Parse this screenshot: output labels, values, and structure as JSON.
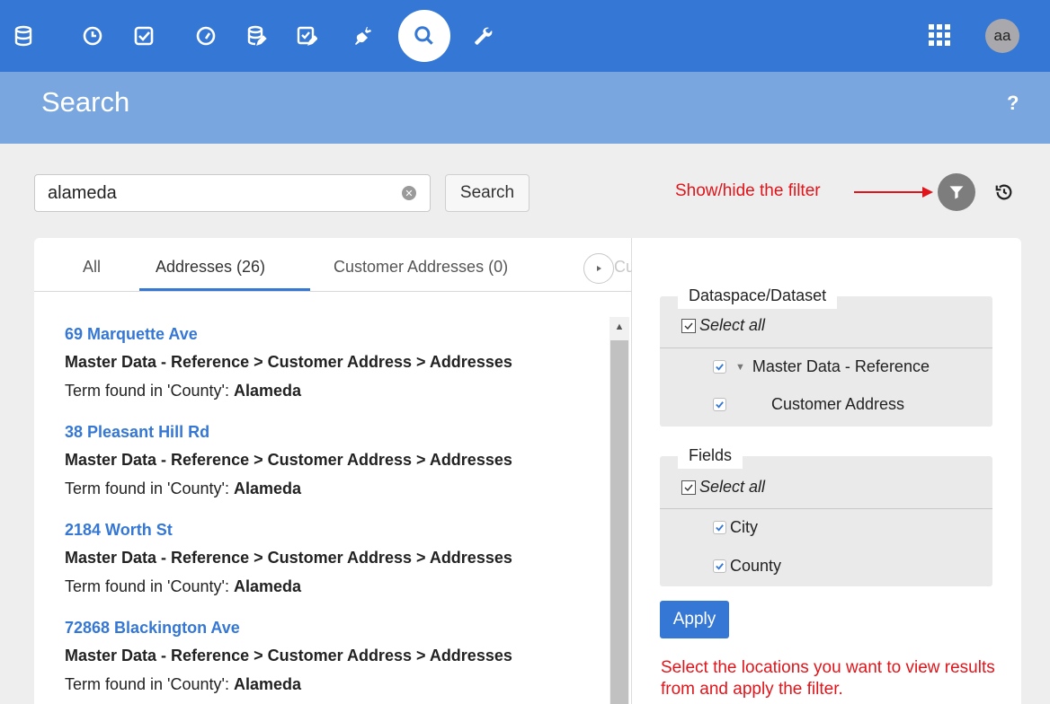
{
  "topbar": {
    "icons": [
      "database-icon",
      "clock-icon",
      "checkbox-icon",
      "gauge-icon",
      "database-edit-icon",
      "checklist-edit-icon",
      "plug-icon",
      "search-icon",
      "wrench-icon"
    ],
    "active_icon": "search-icon",
    "apps_icon": "apps-grid-icon",
    "avatar_initials": "aa",
    "colors": {
      "bar": "#3577d4",
      "title_bar": "#79a6de"
    }
  },
  "header": {
    "title": "Search",
    "help": "?"
  },
  "search": {
    "query": "alameda",
    "button_label": "Search",
    "filter_annotation": "Show/hide the filter"
  },
  "tabs": [
    {
      "label": "All",
      "active": false
    },
    {
      "label": "Addresses (26)",
      "active": true
    },
    {
      "label": "Customer Addresses (0)",
      "active": false
    },
    {
      "label": "Cust",
      "active": false
    }
  ],
  "results": [
    {
      "title": "69 Marquette Ave",
      "path": "Master Data - Reference > Customer Address > Addresses",
      "term_prefix": "Term found in 'County': ",
      "term_value": "Alameda"
    },
    {
      "title": "38 Pleasant Hill Rd",
      "path": "Master Data - Reference > Customer Address > Addresses",
      "term_prefix": "Term found in 'County': ",
      "term_value": "Alameda"
    },
    {
      "title": "2184 Worth St",
      "path": "Master Data - Reference > Customer Address > Addresses",
      "term_prefix": "Term found in 'County': ",
      "term_value": "Alameda"
    },
    {
      "title": "72868 Blackington Ave",
      "path": "Master Data - Reference > Customer Address > Addresses",
      "term_prefix": "Term found in 'County': ",
      "term_value": "Alameda"
    }
  ],
  "filter": {
    "dataspace": {
      "legend": "Dataspace/Dataset",
      "select_all": "Select all",
      "items": [
        {
          "label": "Master Data - Reference",
          "checked": true
        },
        {
          "label": "Customer Address",
          "checked": true
        }
      ]
    },
    "fields": {
      "legend": "Fields",
      "select_all": "Select all",
      "items": [
        {
          "label": "City",
          "checked": true
        },
        {
          "label": "County",
          "checked": true
        }
      ]
    },
    "apply_label": "Apply",
    "apply_annotation": "Select the locations you want to view results from and apply the filter."
  }
}
